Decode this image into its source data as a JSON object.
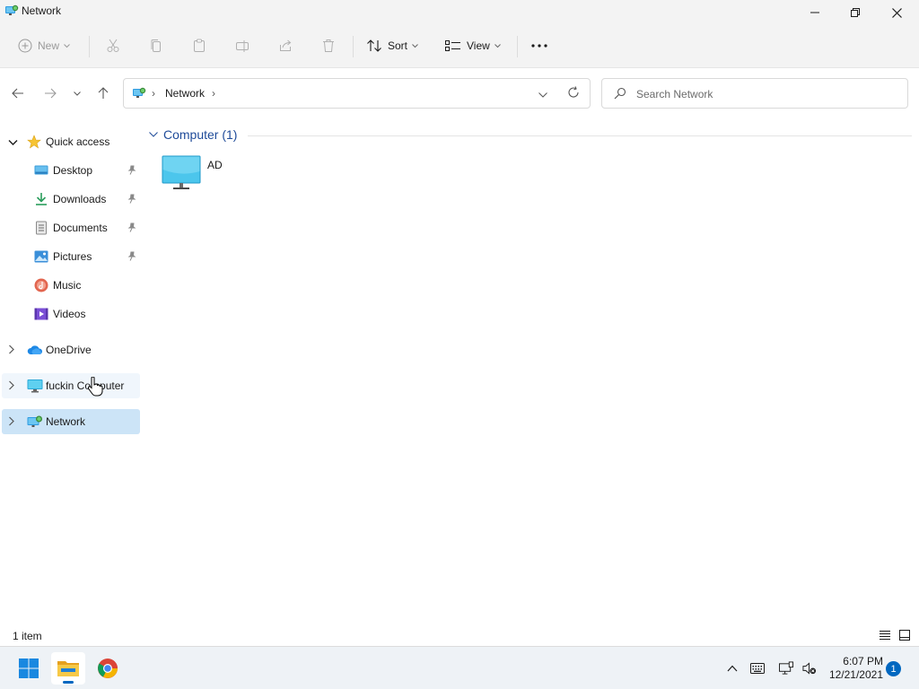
{
  "window": {
    "title": "Network",
    "app_icon": "network-icon",
    "controls": [
      "minimize-icon",
      "maximize-icon",
      "close-icon"
    ]
  },
  "command_bar": {
    "new_label": "New",
    "sort_label": "Sort",
    "view_label": "View",
    "disabled_icons": [
      "cut-icon",
      "copy-icon",
      "paste-icon",
      "rename-icon",
      "share-icon",
      "delete-icon"
    ],
    "more_icon": "more-icon"
  },
  "navigation": {
    "back_icon": "arrow-left-icon",
    "forward_icon": "arrow-right-icon",
    "recent_icon": "chevron-down-icon",
    "up_icon": "arrow-up-icon"
  },
  "address_bar": {
    "breadcrumbs": [
      "Network"
    ],
    "icon": "network-icon"
  },
  "search": {
    "placeholder": "Search Network",
    "value": ""
  },
  "sidebar": {
    "quick_access": {
      "label": "Quick access",
      "expanded": true,
      "items": [
        {
          "label": "Desktop",
          "icon": "desktop-icon",
          "pinned": true
        },
        {
          "label": "Downloads",
          "icon": "downloads-icon",
          "pinned": true
        },
        {
          "label": "Documents",
          "icon": "documents-icon",
          "pinned": true
        },
        {
          "label": "Pictures",
          "icon": "pictures-icon",
          "pinned": true
        },
        {
          "label": "Music",
          "icon": "music-icon",
          "pinned": false
        },
        {
          "label": "Videos",
          "icon": "videos-icon",
          "pinned": false
        }
      ]
    },
    "onedrive": {
      "label": "OneDrive",
      "icon": "onedrive-icon"
    },
    "this_pc": {
      "label": "fuckin Computer",
      "icon": "computer-icon",
      "state": "hover"
    },
    "network": {
      "label": "Network",
      "icon": "network-icon",
      "state": "selected"
    }
  },
  "content": {
    "group": {
      "title": "Computer (1)",
      "items": [
        {
          "name": "AD",
          "icon": "computer-icon"
        }
      ]
    }
  },
  "status_bar": {
    "item_count": "1 item",
    "view_icons": [
      "details-view-icon",
      "tiles-view-icon"
    ]
  },
  "taskbar": {
    "apps": [
      "start-icon",
      "file-explorer-icon",
      "chrome-icon"
    ],
    "active_app": "file-explorer-icon",
    "tray": [
      "chevron-up-icon",
      "keyboard-icon",
      "network-status-icon",
      "volume-muted-icon"
    ],
    "time": "6:07 PM",
    "date": "12/21/2021",
    "notification_count": "1"
  },
  "colors": {
    "accent": "#0067c0",
    "selected_bg": "#cce4f7",
    "group_header": "#1f4b99",
    "chrome_bg": "#f3f3f3"
  }
}
